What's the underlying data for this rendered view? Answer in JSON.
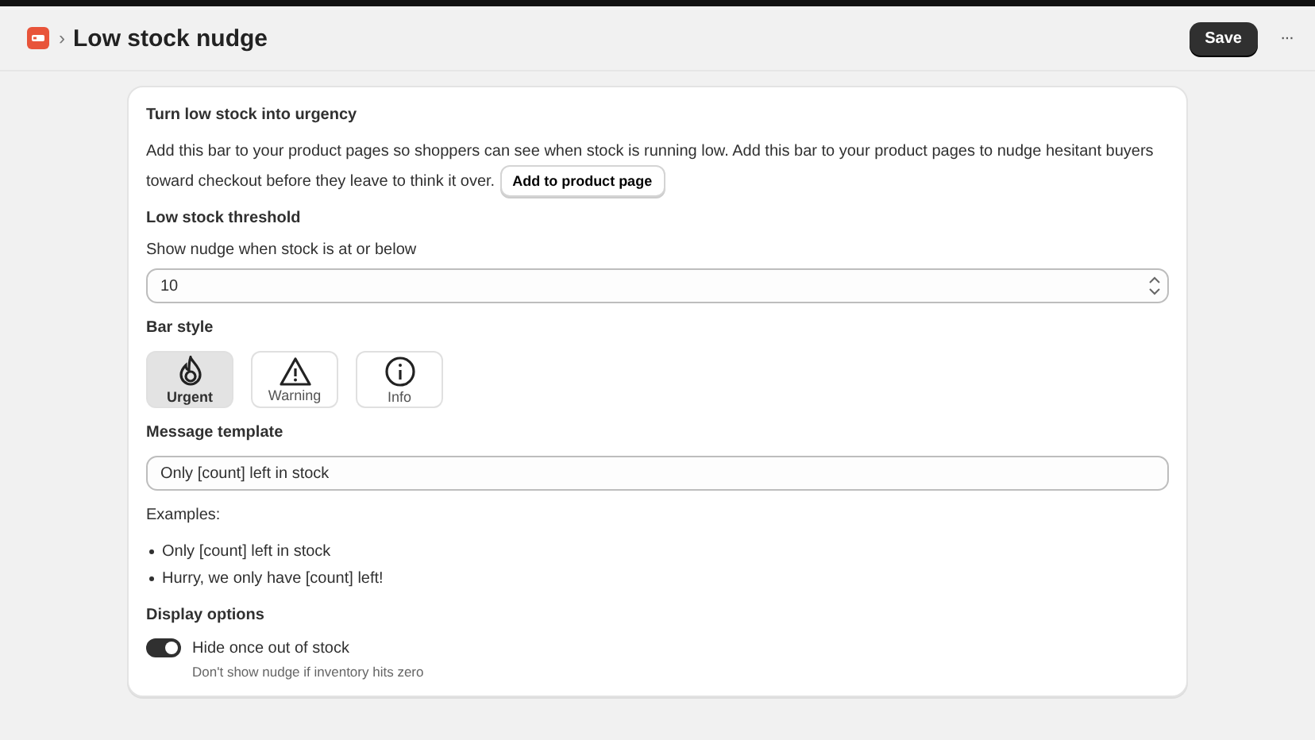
{
  "header": {
    "breadcrumb_separator": "›",
    "title": "Low stock nudge",
    "save": "Save",
    "more": "···"
  },
  "intro": {
    "heading": "Turn low stock into urgency",
    "text_lines": [
      "Add this bar to your product pages so shoppers can see when stock is running low. Add this bar to your product pages to nudge hesitant buyers",
      "toward checkout before they leave to think it over."
    ],
    "button": "Add to product page"
  },
  "threshold": {
    "heading": "Low stock threshold",
    "label": "Show nudge when stock is at or below",
    "value": "10"
  },
  "bar_style": {
    "heading": "Bar style",
    "options": [
      {
        "kind": "urgent",
        "label": "Urgent",
        "selected": true
      },
      {
        "kind": "warning",
        "label": "Warning",
        "selected": false
      },
      {
        "kind": "info",
        "label": "Info",
        "selected": false
      }
    ]
  },
  "message": {
    "heading": "Message template",
    "value": "Only [count] left in stock",
    "examples_label": "Examples:",
    "examples": [
      "Only [count] left in stock",
      "Hurry, we only have [count] left!"
    ]
  },
  "display": {
    "heading": "Display options",
    "toggle": {
      "label": "Hide once out of stock",
      "help": "Don't show nudge if inventory hits zero",
      "on": true
    }
  }
}
